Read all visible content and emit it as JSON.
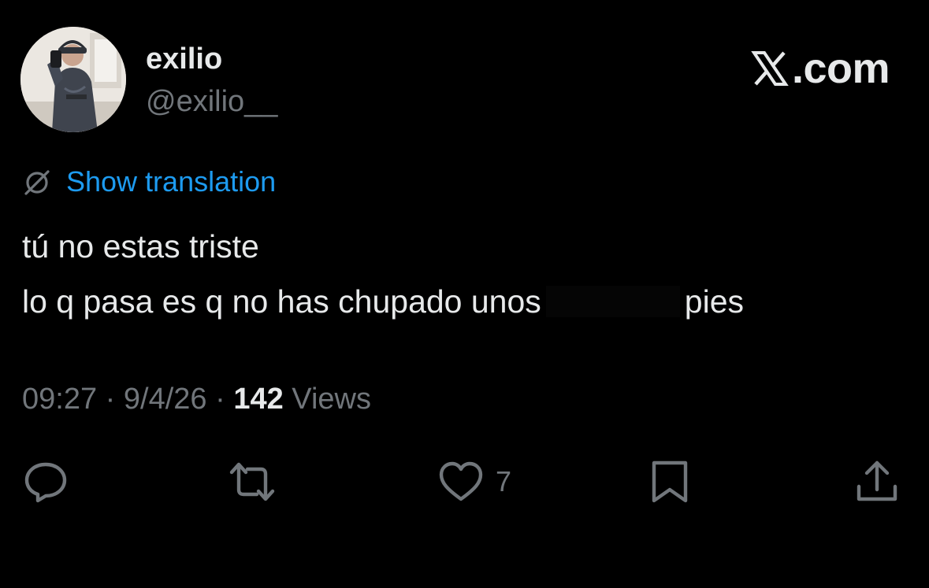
{
  "user": {
    "display_name": "exilio",
    "handle": "@exilio__"
  },
  "brand": {
    "suffix": ".com",
    "logo_icon": "x-logo-icon"
  },
  "translation": {
    "label": "Show translation",
    "icon": "translate-globe-icon"
  },
  "tweet": {
    "line1": "tú no estas triste",
    "line2_before": "lo q pasa es q no has chupado unos",
    "line2_after": "pies"
  },
  "meta": {
    "time": "09:27",
    "separator": "·",
    "date": "9/4/26",
    "views_count": "142",
    "views_label": "Views"
  },
  "actions": {
    "reply_icon": "reply-bubble-icon",
    "retweet_icon": "retweet-icon",
    "like_icon": "heart-icon",
    "like_count": "7",
    "bookmark_icon": "bookmark-icon",
    "share_icon": "share-icon"
  },
  "colors": {
    "background": "#000000",
    "primary_text": "#e7e9ea",
    "secondary_text": "#71767b",
    "link": "#1d9bf0"
  }
}
